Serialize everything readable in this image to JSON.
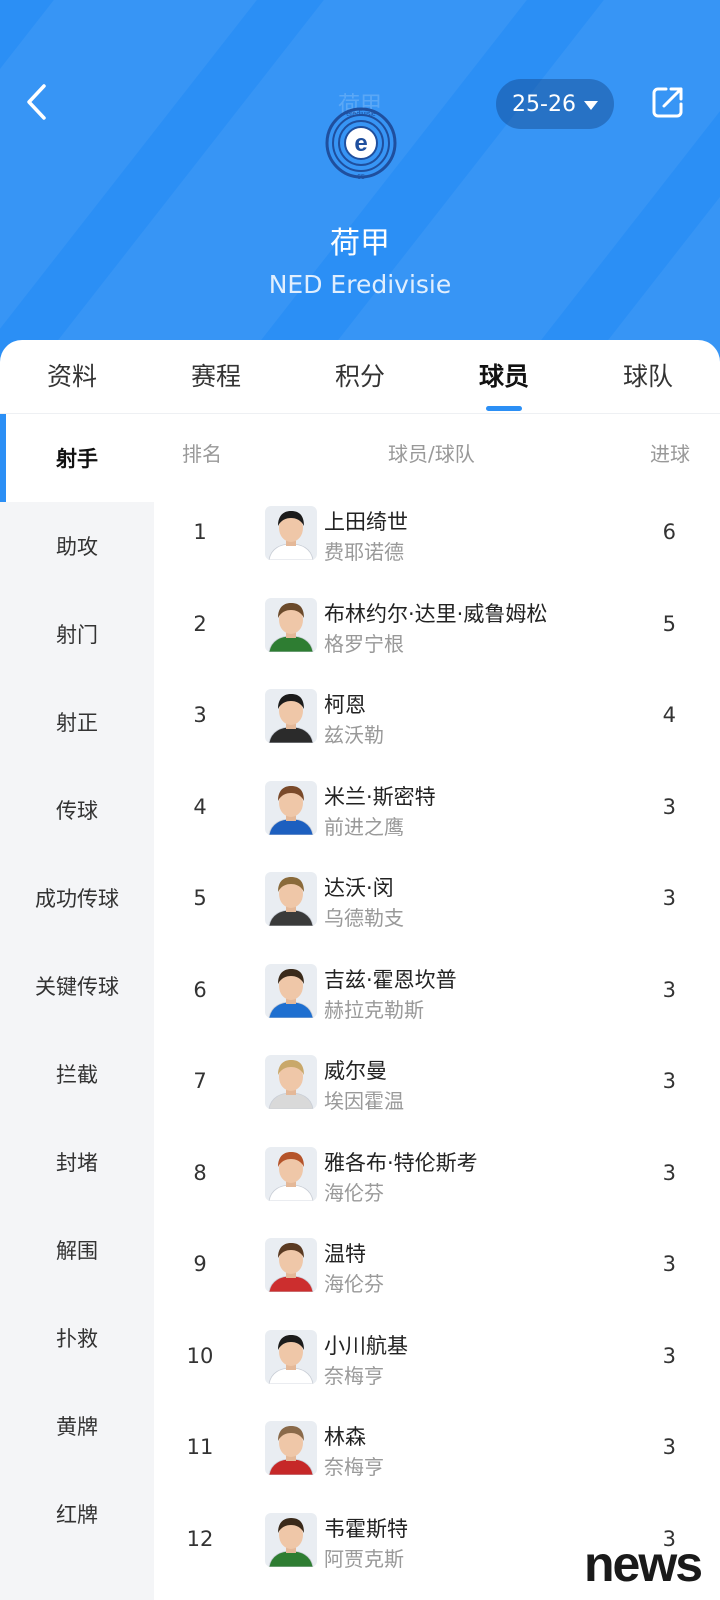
{
  "header": {
    "ghost_title": "荷甲",
    "season": "25-26",
    "league_name_cn": "荷甲",
    "league_name_en": "NED Eredivisie",
    "logo_text": "eredivisie",
    "logo_number": "65"
  },
  "tabs": [
    {
      "label": "资料"
    },
    {
      "label": "赛程"
    },
    {
      "label": "积分"
    },
    {
      "label": "球员",
      "active": true
    },
    {
      "label": "球队"
    }
  ],
  "categories": [
    {
      "label": "射手",
      "active": true
    },
    {
      "label": "助攻"
    },
    {
      "label": "射门"
    },
    {
      "label": "射正"
    },
    {
      "label": "传球"
    },
    {
      "label": "成功传球"
    },
    {
      "label": "关键传球"
    },
    {
      "label": "拦截"
    },
    {
      "label": "封堵"
    },
    {
      "label": "解围"
    },
    {
      "label": "扑救"
    },
    {
      "label": "黄牌"
    },
    {
      "label": "红牌"
    }
  ],
  "table": {
    "col_rank": "排名",
    "col_player": "球员/球队",
    "col_goals": "进球",
    "rows": [
      {
        "rank": "1",
        "player": "上田绮世",
        "team": "费耶诺德",
        "goals": "6",
        "kit": "#ffffff",
        "hair": "#1b1b1b"
      },
      {
        "rank": "2",
        "player": "布林约尔·达里·威鲁姆松",
        "team": "格罗宁根",
        "goals": "5",
        "kit": "#2e7d32",
        "hair": "#6b4a2b"
      },
      {
        "rank": "3",
        "player": "柯恩",
        "team": "兹沃勒",
        "goals": "4",
        "kit": "#2b2b2b",
        "hair": "#1b1b1b"
      },
      {
        "rank": "4",
        "player": "米兰·斯密特",
        "team": "前进之鹰",
        "goals": "3",
        "kit": "#1d5fbf",
        "hair": "#7a4a2a"
      },
      {
        "rank": "5",
        "player": "达沃·闵",
        "team": "乌德勒支",
        "goals": "3",
        "kit": "#3a3a3a",
        "hair": "#8a6a3a"
      },
      {
        "rank": "6",
        "player": "吉兹·霍恩坎普",
        "team": "赫拉克勒斯",
        "goals": "3",
        "kit": "#1e6fd0",
        "hair": "#3a2a1a"
      },
      {
        "rank": "7",
        "player": "威尔曼",
        "team": "埃因霍温",
        "goals": "3",
        "kit": "#d9d9d9",
        "hair": "#c9a86a"
      },
      {
        "rank": "8",
        "player": "雅各布·特伦斯考",
        "team": "海伦芬",
        "goals": "3",
        "kit": "#ffffff",
        "hair": "#b5542a"
      },
      {
        "rank": "9",
        "player": "温特",
        "team": "海伦芬",
        "goals": "3",
        "kit": "#cc2e2e",
        "hair": "#5a3a22"
      },
      {
        "rank": "10",
        "player": "小川航基",
        "team": "奈梅亨",
        "goals": "3",
        "kit": "#ffffff",
        "hair": "#1b1b1b"
      },
      {
        "rank": "11",
        "player": "林森",
        "team": "奈梅亨",
        "goals": "3",
        "kit": "#c62828",
        "hair": "#8a6a4a"
      },
      {
        "rank": "12",
        "player": "韦霍斯特",
        "team": "阿贾克斯",
        "goals": "3",
        "kit": "#2e7d32",
        "hair": "#3a2a1a"
      }
    ]
  },
  "watermark": "news",
  "colors": {
    "accent": "#2b8ff5",
    "header_bg": "#2b8ff5",
    "side_bg": "#f4f5f7",
    "muted_text": "#999999"
  }
}
